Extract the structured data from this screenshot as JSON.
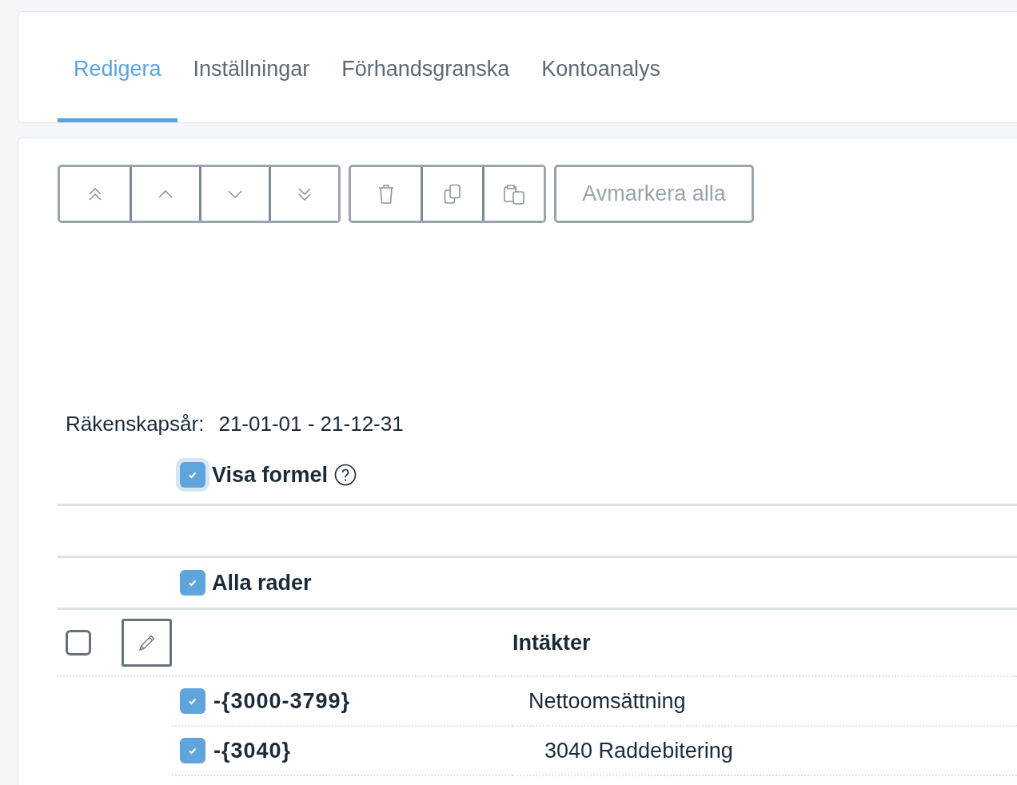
{
  "tabs": [
    {
      "label": "Redigera",
      "selected": true
    },
    {
      "label": "Inställningar",
      "selected": false
    },
    {
      "label": "Förhandsgranska",
      "selected": false
    },
    {
      "label": "Kontoanalys",
      "selected": false
    }
  ],
  "toolbar": {
    "deselect_all": "Avmarkera alla"
  },
  "fiscal_year": {
    "label": "Räkenskapsår:",
    "value": "21-01-01 - 21-12-31"
  },
  "show_formula": {
    "label": "Visa formel",
    "checked": true
  },
  "all_rows": {
    "label": "Alla rader",
    "checked": true
  },
  "rows": [
    {
      "kind": "section",
      "label": "Intäkter",
      "checked": false,
      "children": [
        {
          "kind": "account",
          "formula": "-{3000-3799}",
          "label": "Nettoomsättning",
          "checked": true,
          "children": [
            {
              "kind": "account",
              "formula": "-{3040}",
              "label": "3040 Raddebitering",
              "checked": true
            }
          ]
        }
      ]
    }
  ]
}
